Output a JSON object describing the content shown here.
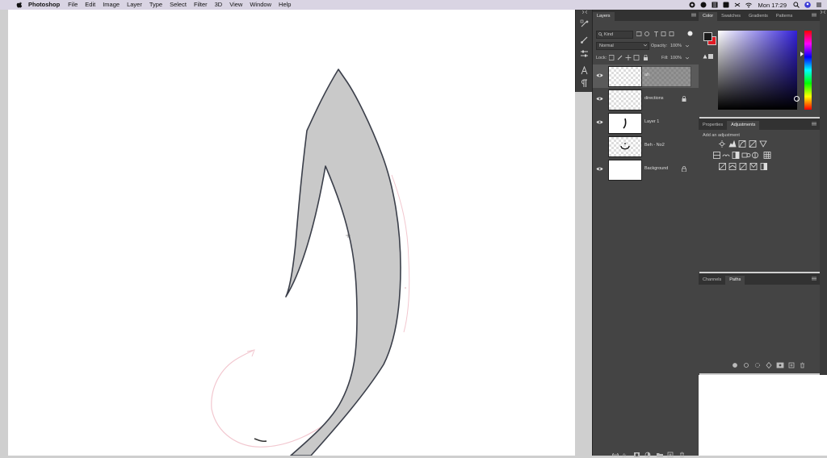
{
  "menubar": {
    "app_name": "Photoshop",
    "items": [
      "File",
      "Edit",
      "Image",
      "Layer",
      "Type",
      "Select",
      "Filter",
      "3D",
      "View",
      "Window",
      "Help"
    ],
    "clock": "Mon 17:29"
  },
  "layers_panel": {
    "tab": "Layers",
    "kind_filter": "Kind",
    "blend_mode": "Normal",
    "opacity_label": "Opacity:",
    "opacity_value": "100%",
    "lock_label": "Lock:",
    "fill_label": "Fill:",
    "fill_value": "100%",
    "layers": [
      {
        "name": "ah",
        "visible": true,
        "selected": true,
        "thumb": "checker",
        "locked": false
      },
      {
        "name": "directions",
        "visible": true,
        "selected": false,
        "thumb": "checker",
        "locked": true
      },
      {
        "name": "Layer 1",
        "visible": true,
        "selected": false,
        "thumb": "white",
        "locked": false
      },
      {
        "name": "Beh - No2",
        "visible": false,
        "selected": false,
        "thumb": "checker",
        "locked": false
      },
      {
        "name": "Background",
        "visible": true,
        "selected": false,
        "thumb": "white",
        "locked": true
      }
    ]
  },
  "color_panel": {
    "tabs": [
      "Color",
      "Swatches",
      "Gradients",
      "Patterns"
    ],
    "foreground": "#1a1a1a",
    "background": "#e01b24"
  },
  "adjustments_panel": {
    "tabs": [
      "Properties",
      "Adjustments"
    ],
    "hint": "Add an adjustment"
  },
  "paths_panel": {
    "tabs": [
      "Channels",
      "Paths"
    ]
  }
}
